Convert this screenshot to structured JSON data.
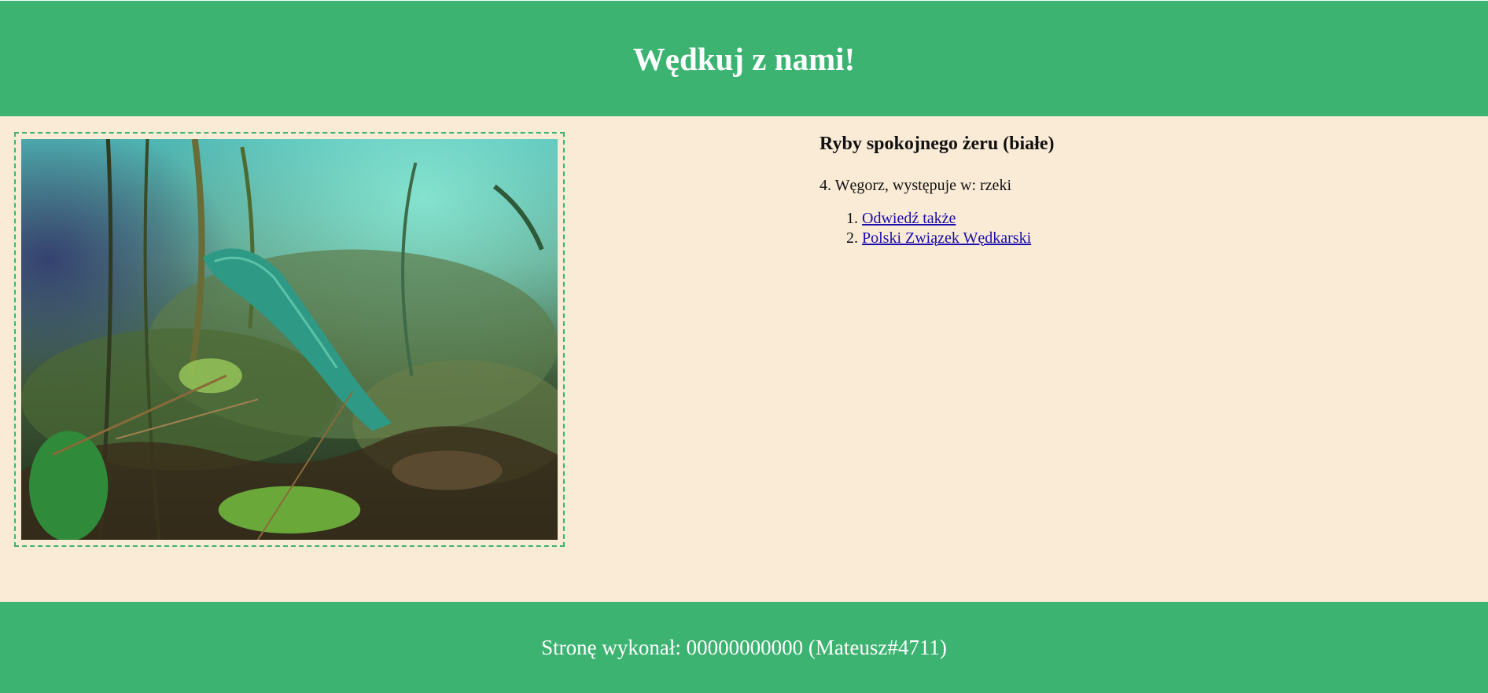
{
  "header": {
    "title": "Wędkuj z nami!"
  },
  "main": {
    "image": {
      "subject": "underwater-pike-among-plants"
    },
    "heading": "Ryby spokojnego żeru (białe)",
    "fish_line": "4. Węgorz, występuje w: rzeki",
    "links": [
      "Odwiedź także",
      "Polski Związek Wędkarski"
    ]
  },
  "footer": {
    "text": "Stronę wykonał: 00000000000 (Mateusz#4711)"
  },
  "colors": {
    "primary": "#3cb371",
    "background": "#faebd7",
    "link": "#1a0dab",
    "heading_text": "#ffffff"
  }
}
